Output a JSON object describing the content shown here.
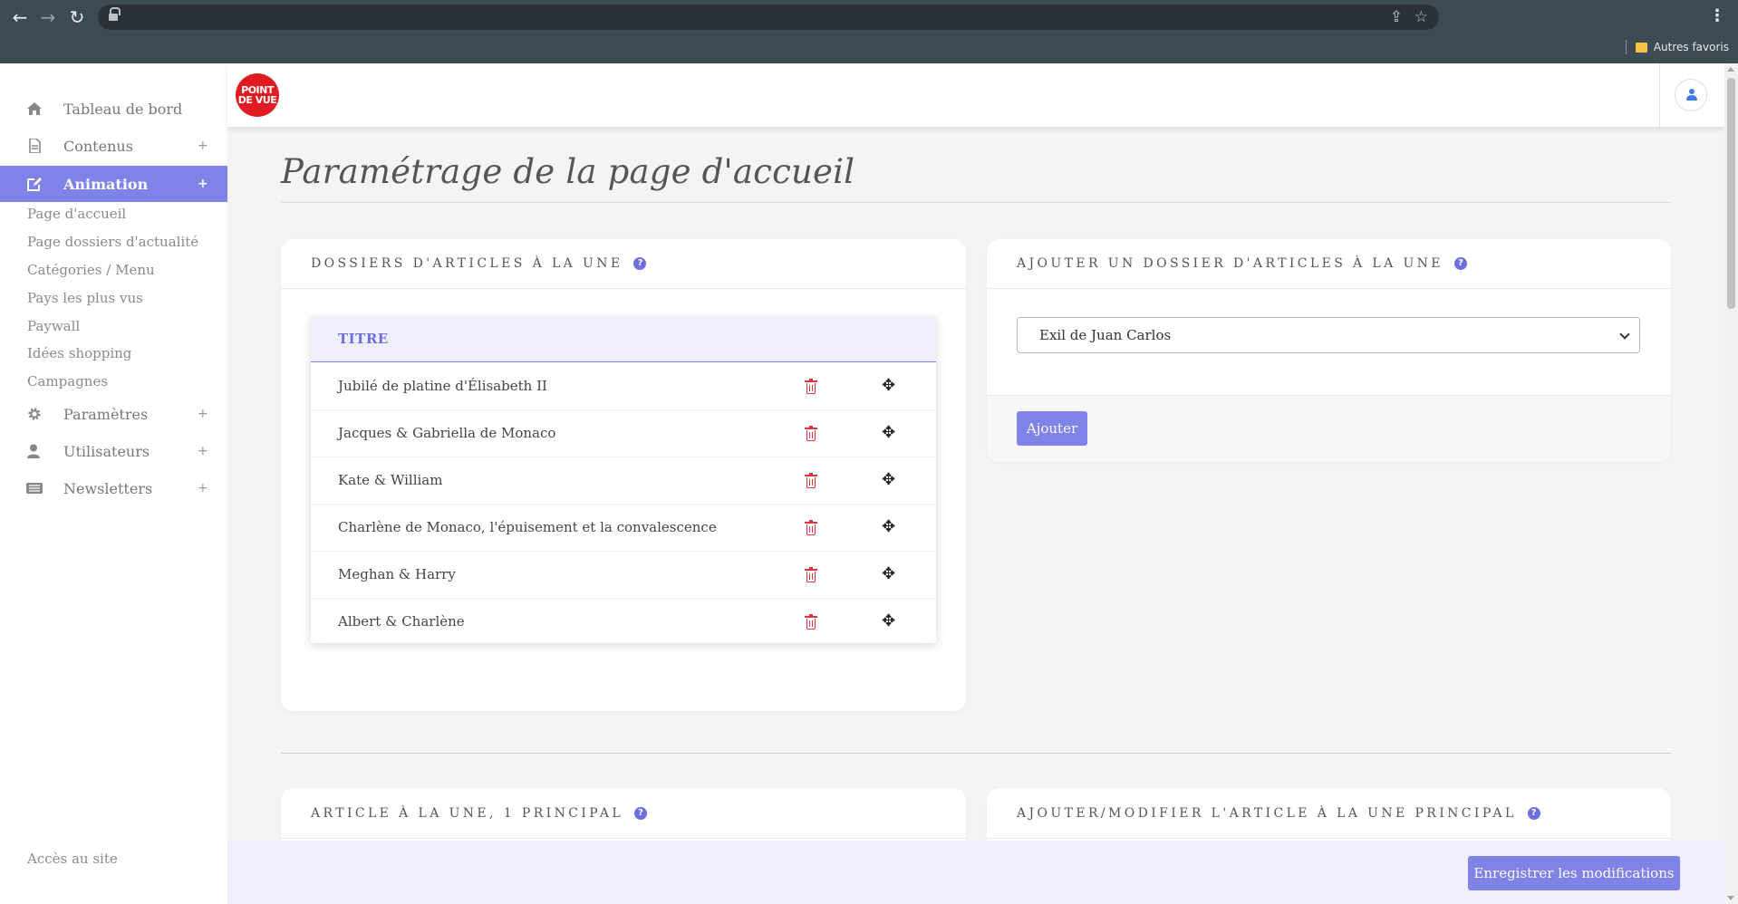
{
  "browser": {
    "bookmarks_label": "Autres favoris",
    "back_icon": "arrow-left-icon",
    "forward_icon": "arrow-right-icon",
    "reload_icon": "reload-icon"
  },
  "sidebar": {
    "items": [
      {
        "label": "Tableau de bord",
        "icon": "home-icon"
      },
      {
        "label": "Contenus",
        "icon": "document-icon",
        "expand": "+"
      },
      {
        "label": "Animation",
        "icon": "edit-icon",
        "expand": "+",
        "active": true
      },
      {
        "label": "Paramètres",
        "icon": "gear-icon",
        "expand": "+"
      },
      {
        "label": "Utilisateurs",
        "icon": "user-icon",
        "expand": "+"
      },
      {
        "label": "Newsletters",
        "icon": "newsletter-icon",
        "expand": "+"
      }
    ],
    "sub_items": [
      "Page d'accueil",
      "Page dossiers d'actualité",
      "Catégories / Menu",
      "Pays les plus vus",
      "Paywall",
      "Idées shopping",
      "Campagnes"
    ],
    "footer_link": "Accès au site"
  },
  "header": {
    "logo_line1": "POINT",
    "logo_line2": "DE VUE"
  },
  "page": {
    "title": "Paramétrage de la page d'accueil"
  },
  "dossiers_card": {
    "heading": "DOSSIERS D'ARTICLES À LA UNE",
    "column_title": "TITRE",
    "rows": [
      "Jubilé de platine d'Élisabeth II",
      "Jacques & Gabriella de Monaco",
      "Kate & William",
      "Charlène de Monaco, l'épuisement et la convalescence",
      "Meghan & Harry",
      "Albert & Charlène"
    ]
  },
  "ajouter_card": {
    "heading": "AJOUTER UN DOSSIER D'ARTICLES À LA UNE",
    "selected_option": "Exil de Juan Carlos",
    "button_label": "Ajouter"
  },
  "article_card": {
    "heading": "ARTICLE À LA UNE, 1 PRINCIPAL"
  },
  "modifier_card": {
    "heading": "AJOUTER/MODIFIER L'ARTICLE À LA UNE PRINCIPAL"
  },
  "footer": {
    "save_label": "Enregistrer les modifications"
  },
  "colors": {
    "accent": "#7f82e6",
    "danger": "#d9363e",
    "logo_red": "#e11b22"
  }
}
